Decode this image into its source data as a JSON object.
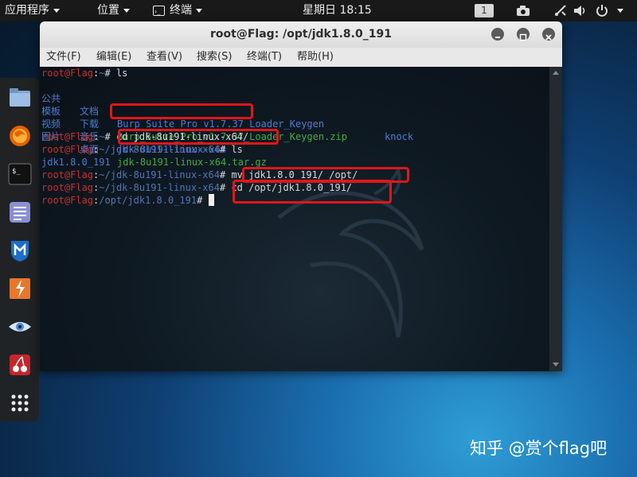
{
  "top_panel": {
    "apps_label": "应用程序",
    "places_label": "位置",
    "terminal_label": "终端",
    "clock": "星期日 18:15",
    "workspace": "1"
  },
  "window": {
    "title": "root@Flag: /opt/jdk1.8.0_191",
    "menus": [
      "文件(F)",
      "编辑(E)",
      "查看(V)",
      "搜索(S)",
      "终端(T)",
      "帮助(H)"
    ]
  },
  "terminal": {
    "l1": {
      "user": "root@Flag",
      "sep": ":",
      "path": "~",
      "sym": "# ",
      "cmd": "ls"
    },
    "l2": {
      "a": "公共",
      "b": "文档",
      "c": "Burp_Suite_Pro_v1.7.37_Loader_Keygen",
      "d": "knock"
    },
    "l3": {
      "a": "模板",
      "b": "下载",
      "c": "Burp_Suite_Pro_v1.7.37_Loader_Keygen.zip"
    },
    "l4": {
      "a": "视频",
      "b": "音乐",
      "c": "jdk-8u191-linux-x64"
    },
    "l5": {
      "a": "图片",
      "b": "桌面",
      "c": "jdk-8u191-linux-x64.tar.gz"
    },
    "l6": {
      "user": "root@Flag",
      "sep": ":",
      "path": "~",
      "sym": "# ",
      "cmd": "cd jdk-8u191-linux-x64/"
    },
    "l7": {
      "user": "root@Flag",
      "sep": ":",
      "path": "~/jdk-8u191-linux-x64",
      "sym": "# ",
      "cmd": "ls"
    },
    "l8": {
      "text": "jdk1.8.0_191"
    },
    "l9": {
      "user": "root@Flag",
      "sep": ":",
      "path": "~/jdk-8u191-linux-x64",
      "sym": "# ",
      "cmd": "mv jdk1.8.0_191/ /opt/"
    },
    "l10": {
      "user": "root@Flag",
      "sep": ":",
      "path": "~/jdk-8u191-linux-x64",
      "sym": "# ",
      "cmd": "cd /opt/jdk1.8.0_191/"
    },
    "l11": {
      "user": "root@Flag",
      "sep": ":",
      "path": "/opt/jdk1.8.0_191",
      "sym": "# ",
      "cmd": ""
    }
  },
  "dock": [
    "files-icon",
    "firefox-icon",
    "terminal-icon",
    "text-editor-icon",
    "metasploit-icon",
    "burpsuite-icon",
    "eye-icon",
    "cherrytree-icon",
    "show-apps-icon"
  ],
  "colors": {
    "prompt_user": "#cc2f2f",
    "path": "#4f76b8",
    "directory": "#4c7bd0",
    "archive": "#3fae3f",
    "highlight_box": "#e0161a"
  },
  "watermark": "知乎 @赏个flag吧"
}
